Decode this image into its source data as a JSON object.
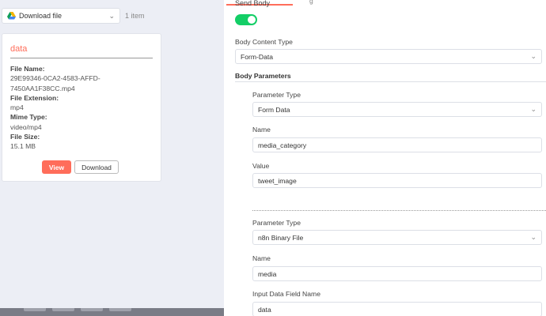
{
  "left": {
    "source_select": {
      "label": "Download file"
    },
    "item_count": "1 item",
    "card": {
      "title": "data",
      "file_name_label": "File Name:",
      "file_name_line1": "29E99346-0CA2-4583-AFFD-",
      "file_name_line2": "7450AA1F38CC.mp4",
      "file_extension_label": "File Extension:",
      "file_extension": "mp4",
      "mime_type_label": "Mime Type:",
      "mime_type": "video/mp4",
      "file_size_label": "File Size:",
      "file_size": "15.1 MB",
      "view_button": "View",
      "download_button": "Download"
    }
  },
  "right": {
    "send_body_label": "Send Body",
    "send_body_enabled": true,
    "body_content_type_label": "Body Content Type",
    "body_content_type_value": "Form-Data",
    "body_parameters_label": "Body Parameters",
    "param1": {
      "type_label": "Parameter Type",
      "type_value": "Form Data",
      "name_label": "Name",
      "name_value": "media_category",
      "value_label": "Value",
      "value_value": "tweet_image"
    },
    "param2": {
      "type_label": "Parameter Type",
      "type_value": "n8n Binary File",
      "name_label": "Name",
      "name_value": "media",
      "input_field_label": "Input Data Field Name",
      "input_field_value": "data"
    }
  },
  "colors": {
    "accent": "#ff6d5a",
    "toggle_on": "#13ce66",
    "google_drive_icon": [
      "#0f9d58",
      "#f4b400",
      "#4285f4"
    ]
  }
}
